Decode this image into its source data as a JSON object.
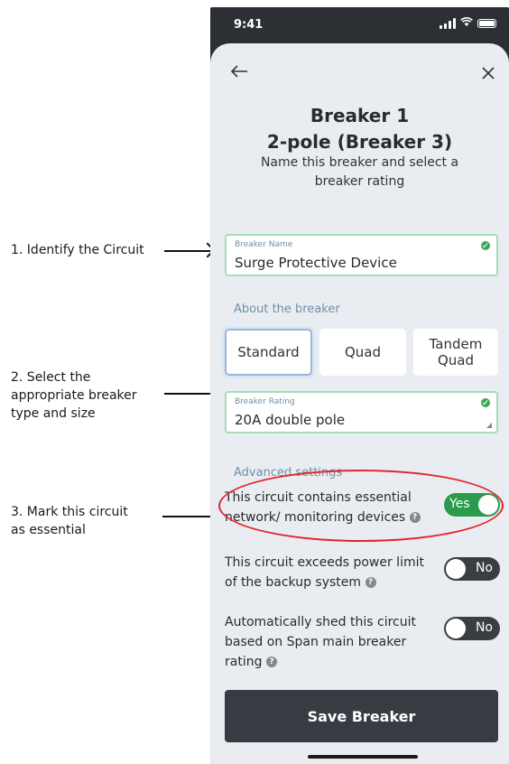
{
  "annotations": {
    "step1": "1. Identify the Circuit",
    "step2_line1": "2. Select the",
    "step2_line2": "appropriate breaker",
    "step2_line3": "type and size",
    "step3_line1": "3. Mark this circuit",
    "step3_line2": "as essential",
    "highlight_color": "#e0252a"
  },
  "status_bar": {
    "time": "9:41"
  },
  "header": {
    "back_icon": "arrow-left-icon",
    "close_icon": "close-icon",
    "title_line1": "Breaker 1",
    "title_line2": "2-pole (Breaker 3)",
    "subtitle": "Name this breaker and select a breaker rating"
  },
  "breaker_name": {
    "label": "Breaker Name",
    "value": "Surge Protective Device"
  },
  "about_section": "About the breaker",
  "breaker_types": [
    {
      "label": "Standard",
      "selected": true
    },
    {
      "label": "Quad",
      "selected": false
    },
    {
      "label": "Tandem Quad",
      "selected": false
    }
  ],
  "breaker_rating": {
    "label": "Breaker Rating",
    "value": "20A double pole"
  },
  "advanced_section": "Advanced settings",
  "toggles": [
    {
      "text": "This circuit contains essential network/ monitoring devices",
      "state": "Yes",
      "on": true
    },
    {
      "text": "This circuit exceeds power limit of the backup system",
      "state": "No",
      "on": false
    },
    {
      "text": "Automatically shed this circuit based on Span main breaker rating",
      "state": "No",
      "on": false
    }
  ],
  "save_button": "Save Breaker",
  "colors": {
    "accent_green": "#2b9a4a",
    "dark_button": "#383c42",
    "sheet_bg": "#e9edf1",
    "section_label": "#6f8fa8"
  }
}
